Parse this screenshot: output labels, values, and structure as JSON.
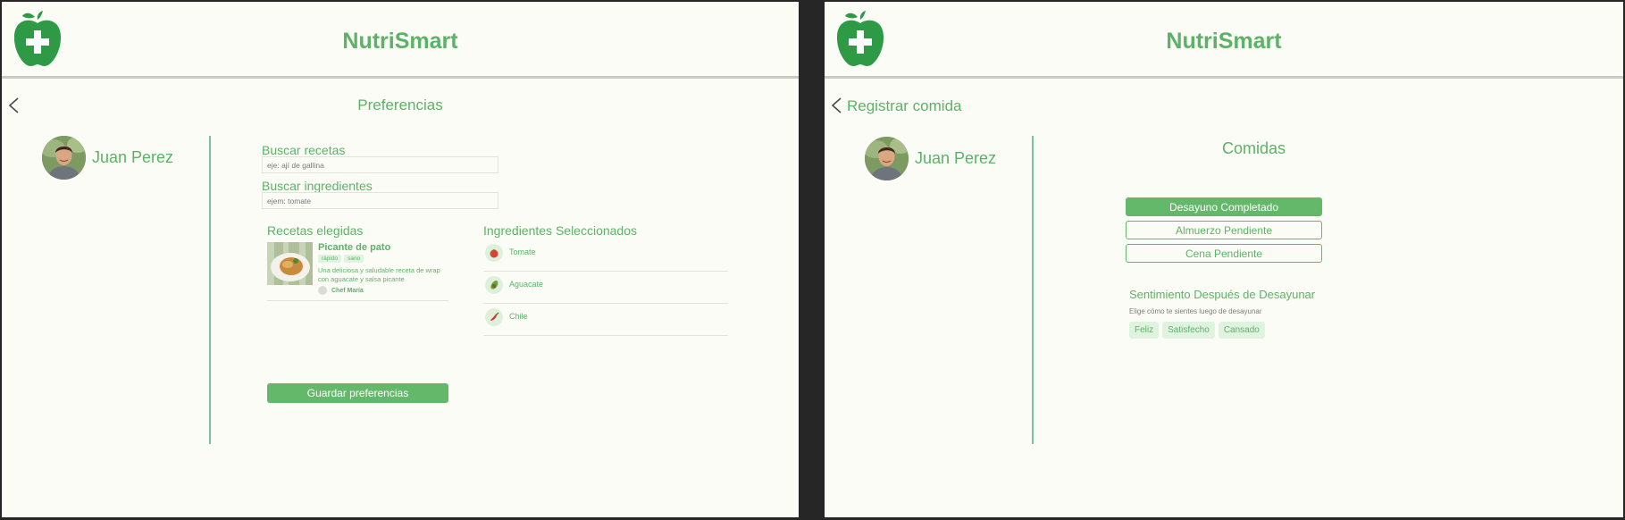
{
  "app": {
    "name": "NutriSmart",
    "accent": "#5cb266",
    "background": "#fcfcf7"
  },
  "user": {
    "name": "Juan Perez"
  },
  "preferences_screen": {
    "page_title": "Preferencias",
    "search_recipes": {
      "label": "Buscar recetas",
      "placeholder": "eje: ají de gallina"
    },
    "search_ingredients": {
      "label": "Buscar ingredientes",
      "placeholder": "ejem: tomate"
    },
    "chosen_recipes_title": "Recetas elegidas",
    "recipe": {
      "title": "Picante de pato",
      "tags": [
        "rápido",
        "sano"
      ],
      "description": "Una deliciosa y saludable receta de wrap con aguacate y salsa picante",
      "chef": "Chef María"
    },
    "selected_ingredients_title": "Ingredientes Seleccionados",
    "ingredients": [
      {
        "label": "Tomate",
        "icon": "tomato-icon"
      },
      {
        "label": "Aguacate",
        "icon": "avocado-icon"
      },
      {
        "label": "Chile",
        "icon": "chili-icon"
      }
    ],
    "save_button": "Guardar preferencias"
  },
  "log_meal_screen": {
    "page_title": "Registrar comida",
    "meals_title": "Comidas",
    "meals": [
      {
        "label": "Desayuno Completado",
        "status": "done"
      },
      {
        "label": "Almuerzo Pendiente",
        "status": "pending"
      },
      {
        "label": "Cena Pendiente",
        "status": "pending"
      }
    ],
    "feeling_title": "Sentimiento Después de Desayunar",
    "feeling_subtitle": "Elige cómo te sientes luego de desayunar",
    "feelings": [
      "Feliz",
      "Satisfecho",
      "Cansado"
    ]
  }
}
